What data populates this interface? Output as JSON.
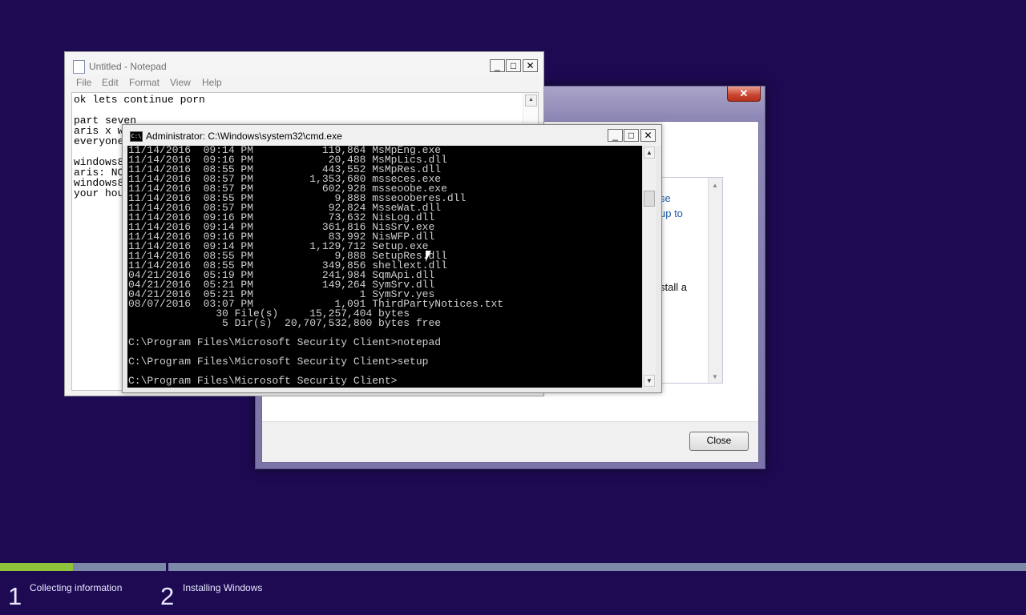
{
  "setup_dialog": {
    "close_x": "✕",
    "inner_text": [
      "se",
      "up to",
      "stall a"
    ],
    "close_button": "Close"
  },
  "notepad": {
    "title": "Untitled - Notepad",
    "menu": [
      "File",
      "Edit",
      "Format",
      "View",
      "Help"
    ],
    "lines": [
      "ok lets continue porn",
      "",
      "part seven",
      "aris x w",
      "everyone",
      "",
      "windows8",
      "aris: NO",
      "windows8",
      "your hou"
    ]
  },
  "cmd": {
    "title": "Administrator: C:\\Windows\\system32\\cmd.exe",
    "icon_label": "C:\\",
    "lines": [
      "11/14/2016  09:14 PM           119,864 MsMpEng.exe",
      "11/14/2016  09:16 PM            20,488 MsMpLics.dll",
      "11/14/2016  08:55 PM           443,552 MsMpRes.dll",
      "11/14/2016  08:57 PM         1,353,680 msseces.exe",
      "11/14/2016  08:57 PM           602,928 msseoobe.exe",
      "11/14/2016  08:55 PM             9,888 msseooberes.dll",
      "11/14/2016  08:57 PM            92,824 MsseWat.dll",
      "11/14/2016  09:16 PM            73,632 NisLog.dll",
      "11/14/2016  09:14 PM           361,816 NisSrv.exe",
      "11/14/2016  09:16 PM            83,992 NisWFP.dll",
      "11/14/2016  09:14 PM         1,129,712 Setup.exe",
      "11/14/2016  08:55 PM             9,888 SetupRes.dll",
      "11/14/2016  08:55 PM           349,856 shellext.dll",
      "04/21/2016  05:19 PM           241,984 SqmApi.dll",
      "04/21/2016  05:21 PM           149,264 SymSrv.dll",
      "04/21/2016  05:21 PM                 1 SymSrv.yes",
      "08/07/2016  03:07 PM             1,091 ThirdPartyNotices.txt",
      "              30 File(s)     15,257,404 bytes",
      "               5 Dir(s)  20,707,532,800 bytes free",
      "",
      "C:\\Program Files\\Microsoft Security Client>notepad",
      "",
      "C:\\Program Files\\Microsoft Security Client>setup",
      "",
      "C:\\Program Files\\Microsoft Security Client>"
    ]
  },
  "window_buttons": {
    "minimize": "_",
    "maximize": "□",
    "close": "✕"
  },
  "progress": {
    "fraction": 0.44,
    "steps": [
      {
        "number": "1",
        "label": "Collecting information"
      },
      {
        "number": "2",
        "label": "Installing Windows"
      }
    ]
  }
}
